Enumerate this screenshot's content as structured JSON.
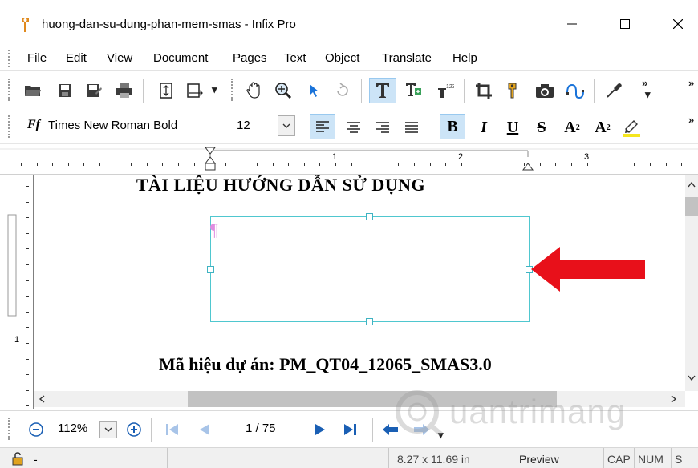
{
  "window": {
    "title": "huong-dan-su-dung-phan-mem-smas - Infix Pro",
    "minimize_glyph": "—",
    "maximize_glyph": "☐",
    "close_glyph": "✕"
  },
  "menu": {
    "items": [
      {
        "label": "File"
      },
      {
        "label": "Edit"
      },
      {
        "label": "View"
      },
      {
        "label": "Document"
      },
      {
        "label": "Pages"
      },
      {
        "label": "Text"
      },
      {
        "label": "Object"
      },
      {
        "label": "Translate"
      },
      {
        "label": "Help"
      }
    ]
  },
  "toolbar_main": {
    "icons": [
      "open-folder-icon",
      "save-icon",
      "save-as-icon",
      "print-icon",
      "page-size-icon",
      "page-fit-icon",
      "hand-icon",
      "zoom-icon",
      "select-arrow-icon",
      "rotate-icon",
      "text-tool-icon",
      "text-edit-icon",
      "superscript-tool-icon",
      "crop-icon",
      "link-icon",
      "snapshot-icon",
      "path-icon",
      "eyedropper-icon"
    ],
    "overflow_glyph": "»"
  },
  "toolbar_format": {
    "font_icon_label": "Ff",
    "font_name": "Times New Roman Bold",
    "font_size": "12",
    "bold_label": "B",
    "italic_label": "I",
    "underline_label": "U",
    "strike_label": "S",
    "superscript_label": "A",
    "superscript_mark": "2",
    "subscript_label": "A",
    "subscript_mark": "2",
    "overflow_glyph": "»"
  },
  "ruler": {
    "labels": [
      "1",
      "2",
      "3"
    ],
    "vertical_label": "1"
  },
  "document": {
    "title": "TÀI LIỆU HƯỚNG DẪN SỬ DỤNG",
    "pilcrow": "¶",
    "project_code": "Mã hiệu dự án:  PM_QT04_12065_SMAS3.0"
  },
  "navigation": {
    "zoom": "112%",
    "page_indicator": "1 / 75"
  },
  "status": {
    "left": "-",
    "page_size": "8.27 x 11.69 in",
    "mode": "Preview",
    "caps": "CAP",
    "num": "NUM",
    "scroll": "S"
  },
  "watermark": {
    "text": "uantrimang"
  },
  "colors": {
    "accent_highlight": "#cce4f7",
    "textbox_border": "#4fc7cf",
    "arrow_red": "#e8101a",
    "pilcrow": "#e08ee0"
  }
}
